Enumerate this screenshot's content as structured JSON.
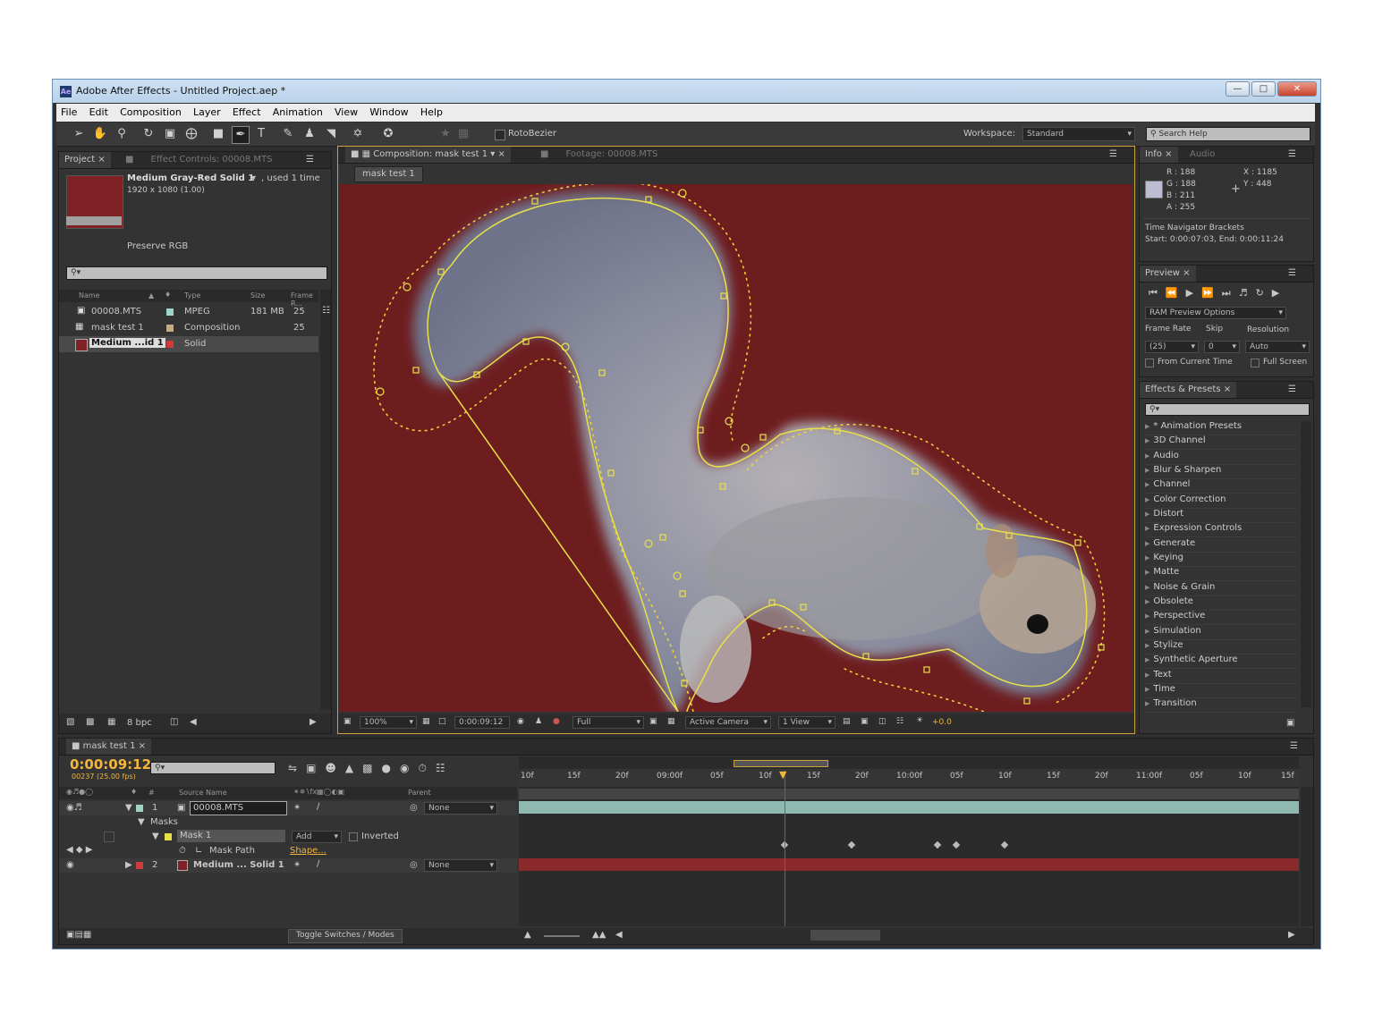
{
  "window": {
    "title": "Adobe After Effects - Untitled Project.aep *",
    "app_icon": "Ae"
  },
  "menu": [
    "File",
    "Edit",
    "Composition",
    "Layer",
    "Effect",
    "Animation",
    "View",
    "Window",
    "Help"
  ],
  "toolbar": {
    "rotobezier_label": "RotoBezier",
    "workspace_label": "Workspace:",
    "workspace_value": "Standard",
    "search_placeholder": "Search Help"
  },
  "project_panel": {
    "tab_project": "Project",
    "tab_effect_controls": "Effect Controls: 00008.MTS",
    "item_name": "Medium Gray-Red Solid 1",
    "item_used": ", used 1 time",
    "item_dims": "1920 x 1080 (1.00)",
    "preserve": "Preserve RGB",
    "columns": [
      "Name",
      "Type",
      "Size",
      "Frame R..."
    ],
    "rows": [
      {
        "name": "00008.MTS",
        "type": "MPEG",
        "size": "181 MB",
        "fps": "25",
        "color": "#9ed3c8"
      },
      {
        "name": "mask test 1",
        "type": "Composition",
        "size": "",
        "fps": "25",
        "color": "#c9a98a"
      },
      {
        "name": "Medium ...id 1",
        "type": "Solid",
        "size": "",
        "fps": "",
        "color": "#d03a3a"
      }
    ],
    "bpc": "8 bpc"
  },
  "comp_panel": {
    "tab_comp": "Composition: mask test 1",
    "tab_footage": "Footage: 00008.MTS",
    "subtab": "mask test 1",
    "zoom": "100%",
    "timecode": "0:00:09:12",
    "resolution": "Full",
    "camera": "Active Camera",
    "views": "1 View",
    "exposure": "+0.0"
  },
  "info_panel": {
    "tab_info": "Info",
    "tab_audio": "Audio",
    "r": "R : 188",
    "g": "G : 188",
    "b": "B : 211",
    "a": "A : 255",
    "x": "X : 1185",
    "y": "Y : 448",
    "nav_title": "Time Navigator Brackets",
    "nav_range": "Start: 0:00:07:03, End: 0:00:11:24"
  },
  "preview_panel": {
    "tab": "Preview",
    "ram_options": "RAM Preview Options",
    "frame_rate_label": "Frame Rate",
    "skip_label": "Skip",
    "resolution_label": "Resolution",
    "frame_rate_value": "(25)",
    "skip_value": "0",
    "resolution_value": "Auto",
    "from_current": "From Current Time",
    "full_screen": "Full Screen"
  },
  "effects_panel": {
    "tab": "Effects & Presets",
    "items": [
      "* Animation Presets",
      "3D Channel",
      "Audio",
      "Blur & Sharpen",
      "Channel",
      "Color Correction",
      "Distort",
      "Expression Controls",
      "Generate",
      "Keying",
      "Matte",
      "Noise & Grain",
      "Obsolete",
      "Perspective",
      "Simulation",
      "Stylize",
      "Synthetic Aperture",
      "Text",
      "Time",
      "Transition"
    ]
  },
  "timeline": {
    "tab": "mask test 1",
    "timecode": "0:00:09:12",
    "frames": "00237 (25.00 fps)",
    "columns": {
      "source": "Source Name",
      "parent": "Parent",
      "num": "#"
    },
    "ruler": [
      "10f",
      "15f",
      "20f",
      "09:00f",
      "05f",
      "10f",
      "15f",
      "20f",
      "10:00f",
      "05f",
      "10f",
      "15f",
      "20f",
      "11:00f",
      "05f",
      "10f",
      "15f"
    ],
    "layers": [
      {
        "num": "1",
        "name": "00008.MTS",
        "parent": "None"
      },
      {
        "num": "2",
        "name": "Medium ... Solid 1",
        "parent": "None"
      }
    ],
    "masks_label": "Masks",
    "mask_name": "Mask 1",
    "mask_mode": "Add",
    "inverted": "Inverted",
    "mask_path": "Mask Path",
    "mask_shape": "Shape...",
    "toggle": "Toggle Switches / Modes"
  },
  "colors": {
    "comp_bg": "#6e1d1f",
    "mask_stroke": "#e8e04a",
    "timecode": "#f2b63a",
    "solid": "#7f2225"
  }
}
